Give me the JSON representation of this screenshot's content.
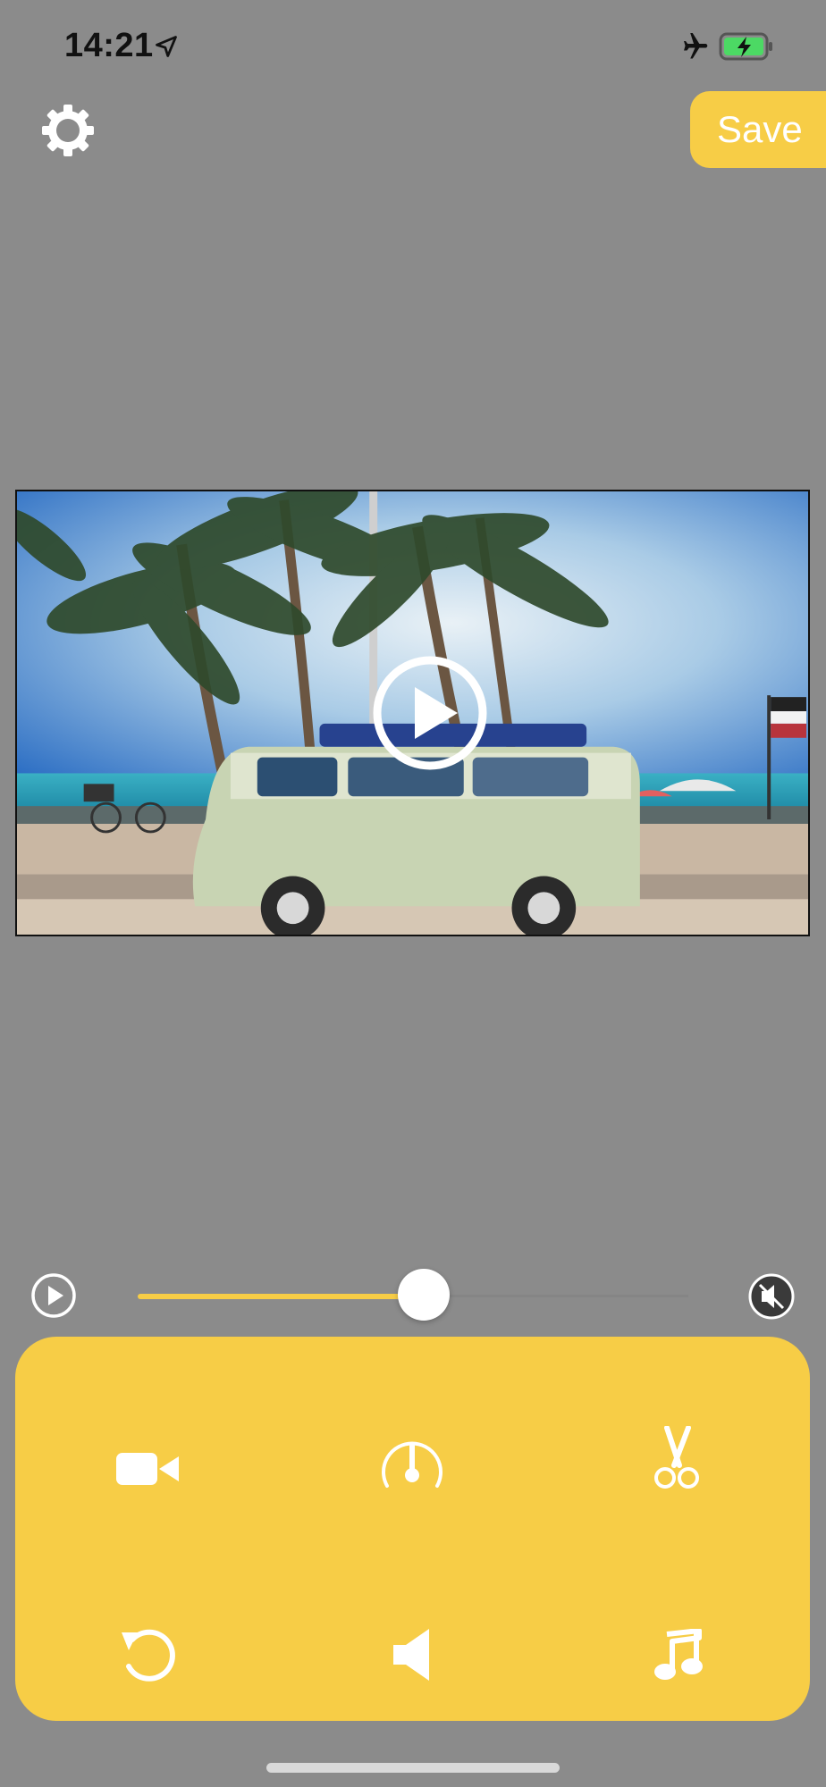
{
  "status_bar": {
    "time": "14:21",
    "icons": [
      "location-arrow-icon",
      "airplane-icon",
      "battery-charging-icon"
    ],
    "battery_color": "#4cd964"
  },
  "top_bar": {
    "settings_icon": "gear-icon",
    "save_label": "Save"
  },
  "video": {
    "overlay_icon": "play-circle-icon"
  },
  "playback": {
    "play_icon": "play-circle-icon",
    "progress": 0.52,
    "mute_icon": "speaker-muted-icon"
  },
  "tools": [
    {
      "name": "video-camera-icon"
    },
    {
      "name": "speed-gauge-icon"
    },
    {
      "name": "scissors-icon"
    },
    {
      "name": "rotate-icon"
    },
    {
      "name": "speaker-icon"
    },
    {
      "name": "music-note-icon"
    }
  ],
  "colors": {
    "background": "#8b8b8b",
    "accent": "#f7cd46",
    "icon": "#ffffff"
  }
}
